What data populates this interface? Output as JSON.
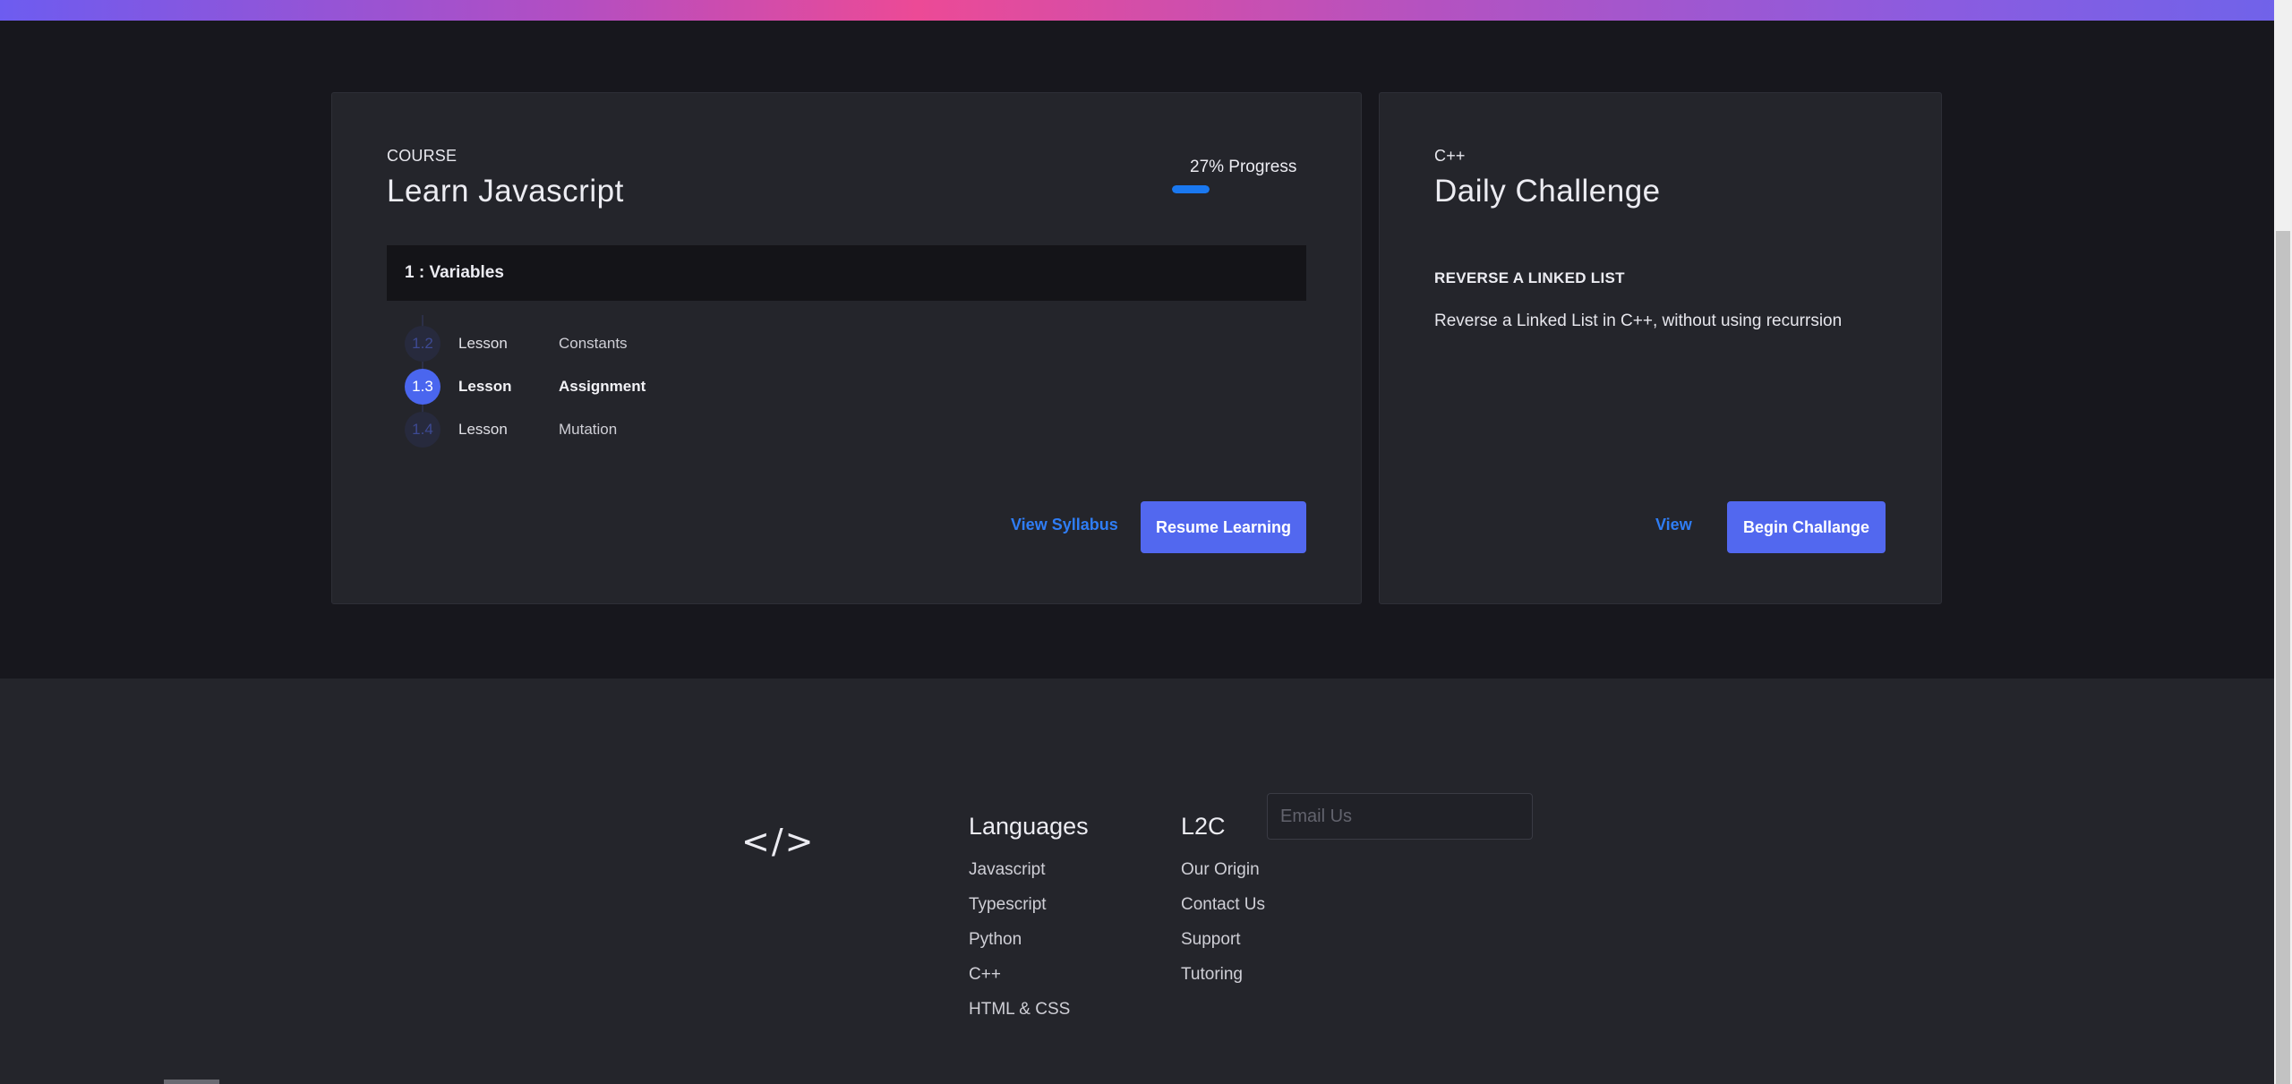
{
  "course_card": {
    "eyebrow": "COURSE",
    "title": "Learn Javascript",
    "progress_label": "27% Progress",
    "progress_value": 0.27,
    "module": "1 : Variables",
    "lessons": [
      {
        "number": "1.2",
        "type": "Lesson",
        "name": "Constants",
        "active": false
      },
      {
        "number": "1.3",
        "type": "Lesson",
        "name": "Assignment",
        "active": true
      },
      {
        "number": "1.4",
        "type": "Lesson",
        "name": "Mutation",
        "active": false
      }
    ],
    "view_syllabus_label": "View Syllabus",
    "resume_label": "Resume Learning"
  },
  "challenge_card": {
    "eyebrow": "C++",
    "title": "Daily Challenge",
    "challenge_name": "REVERSE A LINKED LIST",
    "description": "Reverse a Linked List in C++, without using recurrsion",
    "view_label": "View",
    "begin_label": "Begin Challange"
  },
  "footer": {
    "logo": "</>",
    "languages": {
      "title": "Languages",
      "links": [
        "Javascript",
        "Typescript",
        "Python",
        "C++",
        "HTML & CSS"
      ]
    },
    "l2c": {
      "title": "L2C",
      "links": [
        "Our Origin",
        "Contact Us",
        "Support",
        "Tutoring"
      ]
    },
    "email_placeholder": "Email Us"
  },
  "colors": {
    "accent": "#5268ef",
    "link": "#2f7df5",
    "progress": "#1a78f0",
    "background": "#17171d",
    "card": "#24252b"
  }
}
